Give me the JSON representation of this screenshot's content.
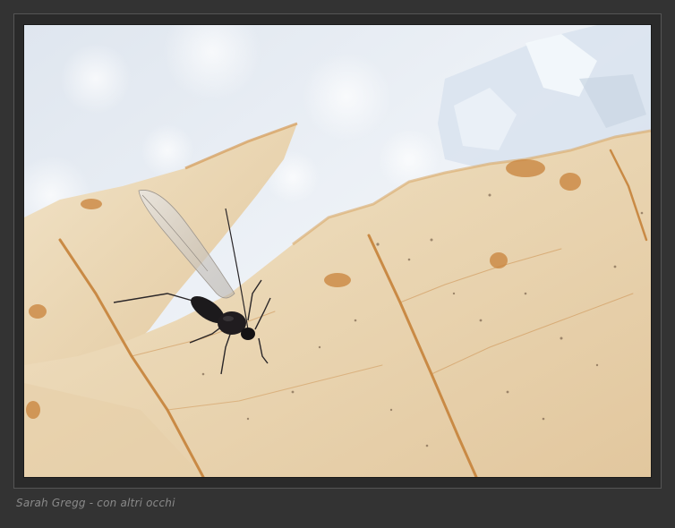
{
  "photo": {
    "subject": "insect-on-leaf-in-snow",
    "colors": {
      "background": "#333333",
      "snow": "#e8eef5",
      "leaf": "#ecd9b6",
      "vein": "#c98a45",
      "insect": "#1c1a1c"
    }
  },
  "caption": {
    "text": "Sarah Gregg - con altri occhi"
  }
}
